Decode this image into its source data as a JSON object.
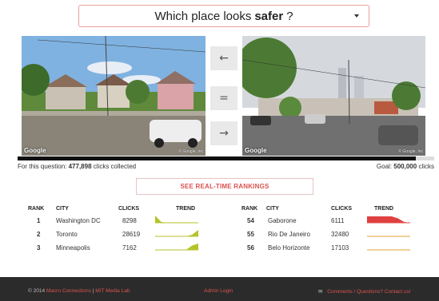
{
  "question": {
    "prefix": "Which place looks",
    "emphasis": "safer",
    "suffix": "?"
  },
  "images": {
    "left": {
      "brand": "Google",
      "copyright": "© Google, Inc"
    },
    "right": {
      "brand": "Google",
      "copyright": "© Google, Inc"
    }
  },
  "vote_buttons": {
    "left": "←",
    "equal": "=",
    "right": "→"
  },
  "progress": {
    "label_prefix": "For this question:",
    "clicks": "477,898",
    "label_suffix": "clicks collected",
    "goal_label": "Goal:",
    "goal": "500,000",
    "goal_suffix": "clicks",
    "fraction": 0.955796
  },
  "rankings_button": "SEE REAL-TIME RANKINGS",
  "rank_table": {
    "headers": {
      "rank": "RANK",
      "city": "CITY",
      "clicks": "CLICKS",
      "trend": "TREND"
    },
    "left_rows": [
      {
        "rank": "1",
        "city": "Washington DC",
        "clicks": "8298",
        "trend": [
          0.9,
          0.1,
          0.0,
          0.0,
          0.0,
          0.0,
          0.0,
          0.0
        ],
        "color": "#b5c32a"
      },
      {
        "rank": "2",
        "city": "Toronto",
        "clicks": "28619",
        "trend": [
          0.0,
          0.0,
          0.0,
          0.0,
          0.0,
          0.0,
          0.2,
          0.8
        ],
        "color": "#b5c32a"
      },
      {
        "rank": "3",
        "city": "Minneapolis",
        "clicks": "7162",
        "trend": [
          0.0,
          0.0,
          0.0,
          0.0,
          0.0,
          0.0,
          0.55,
          0.8
        ],
        "color": "#b5c32a"
      }
    ],
    "right_rows": [
      {
        "rank": "54",
        "city": "Gaborone",
        "clicks": "6111",
        "trend": [
          0.8,
          0.8,
          0.8,
          0.8,
          0.8,
          0.55,
          0.1,
          0.0
        ],
        "color": "#e04040"
      },
      {
        "rank": "55",
        "city": "Rio De Janeiro",
        "clicks": "32480",
        "trend": [
          0.0,
          0.0,
          0.0,
          0.0,
          0.0,
          0.0,
          0.0,
          0.0
        ],
        "color": "#e0a030"
      },
      {
        "rank": "56",
        "city": "Belo Horizonte",
        "clicks": "17103",
        "trend": [
          0.0,
          0.0,
          0.0,
          0.0,
          0.0,
          0.0,
          0.0,
          0.0
        ],
        "color": "#e0a030"
      }
    ]
  },
  "footer": {
    "copyright": "© 2014",
    "macro": "Macro Connections",
    "separator": "|",
    "mit": "MIT Media Lab",
    "admin": "Admin Login",
    "contact_icon": "envelope-icon",
    "contact": "Comments / Questions? Contact us!"
  },
  "colors": {
    "accent": "#d9534f",
    "footer_bg": "#2b2b2b",
    "button_bg": "#e9e9e9"
  }
}
